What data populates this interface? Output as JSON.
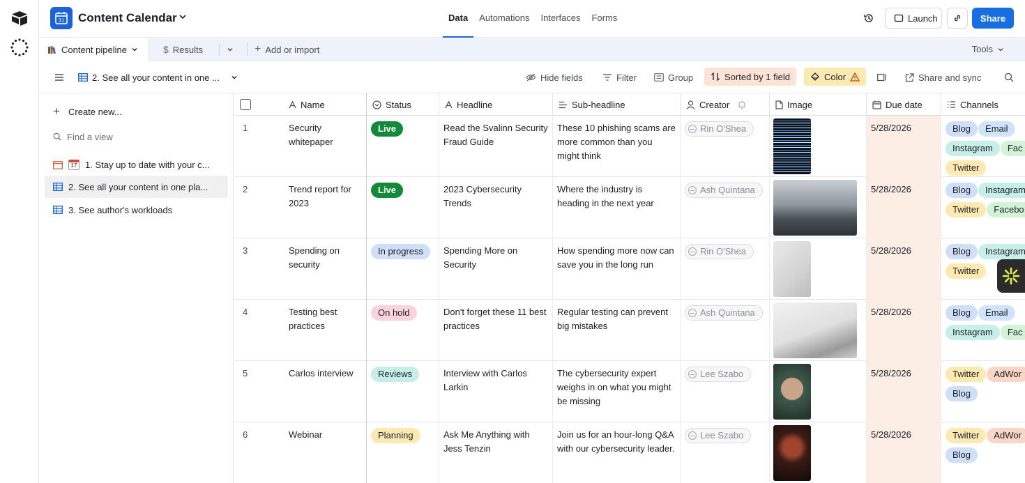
{
  "app": {
    "base_title": "Content Calendar",
    "base_icon_day": "31",
    "tabs": [
      {
        "label": "Data",
        "active": true
      },
      {
        "label": "Automations",
        "active": false
      },
      {
        "label": "Interfaces",
        "active": false
      },
      {
        "label": "Forms",
        "active": false
      }
    ],
    "launch_label": "Launch",
    "share_label": "Share",
    "brand_color": "#166ee1"
  },
  "tablebar": {
    "active_table": "Content pipeline",
    "other_table": "Results",
    "add_label": "Add or import",
    "tools_label": "Tools"
  },
  "viewbar": {
    "view_name": "2. See all your content in one ...",
    "hide_fields": "Hide fields",
    "filter": "Filter",
    "group": "Group",
    "sorted": "Sorted by 1 field",
    "color": "Color",
    "share_sync": "Share and sync"
  },
  "sidebar": {
    "create_new": "Create new...",
    "find_view": "Find a view",
    "views": [
      {
        "label": "1. Stay up to date with your c...",
        "type": "calendar",
        "active": false
      },
      {
        "label": "2. See all your content in one pla...",
        "type": "grid",
        "active": true
      },
      {
        "label": "3. See author's workloads",
        "type": "grid",
        "active": false
      }
    ]
  },
  "columns": [
    "Name",
    "Status",
    "Headline",
    "Sub-headline",
    "Creator",
    "Image",
    "Due date",
    "Channels"
  ],
  "status_colors": {
    "Live": {
      "bg": "#138a3a",
      "fg": "#ffffff"
    },
    "In progress": {
      "bg": "#cfdff8",
      "fg": "#1d1f25"
    },
    "On hold": {
      "bg": "#fbd3dc",
      "fg": "#1d1f25"
    },
    "Reviews": {
      "bg": "#c6efe9",
      "fg": "#1d1f25"
    },
    "Planning": {
      "bg": "#fde9b2",
      "fg": "#1d1f25"
    }
  },
  "channel_colors": {
    "Blog": "#cfdff8",
    "Email": "#cfe4fb",
    "Instagram": "#c6efe9",
    "Facebook": "#d2f3d6",
    "Twitter": "#fde9b2",
    "AdWords": "#fbd6c6"
  },
  "rows": [
    {
      "num": "1",
      "name": "Security whitepaper",
      "status": "Live",
      "headline": "Read the Svalinn Security Fraud Guide",
      "sub": "These 10 phishing scams are more common than you might think",
      "creator": "Rin O'Shea",
      "due": "5/28/2026",
      "channels": [
        "Blog",
        "Email",
        "Instagram",
        "Fac",
        "Twitter"
      ],
      "image": "code"
    },
    {
      "num": "2",
      "name": "Trend report for 2023",
      "status": "Live",
      "headline": "2023 Cybersecurity Trends",
      "sub": "Where the industry is heading in the next year",
      "creator": "Ash Quintana",
      "due": "5/28/2026",
      "channels": [
        "Blog",
        "Instagram",
        "Twitter",
        "Facebo"
      ],
      "image": "office"
    },
    {
      "num": "3",
      "name": "Spending on security",
      "status": "In progress",
      "headline": "Spending More on Security",
      "sub": "How spending more now can save you in the long run",
      "creator": "Rin O'Shea",
      "due": "5/28/2026",
      "channels": [
        "Blog",
        "Instagram",
        "Twitter"
      ],
      "image": "hand"
    },
    {
      "num": "4",
      "name": "Testing best practices",
      "status": "On hold",
      "headline": "Don't forget these 11 best practices",
      "sub": "Regular testing can prevent big mistakes",
      "creator": "Ash Quintana",
      "due": "5/28/2026",
      "channels": [
        "Blog",
        "Email",
        "Instagram",
        "Fac"
      ],
      "image": "laptop"
    },
    {
      "num": "5",
      "name": "Carlos interview",
      "status": "Reviews",
      "headline": "Interview with Carlos Larkin",
      "sub": "The cybersecurity expert weighs in on what you might be missing",
      "creator": "Lee Szabo",
      "due": "5/28/2026",
      "channels": [
        "Twitter",
        "AdWor",
        "Blog"
      ],
      "image": "face"
    },
    {
      "num": "6",
      "name": "Webinar",
      "status": "Planning",
      "headline": "Ask Me Anything with Jess Tenzin",
      "sub": "Join us for an hour-long Q&A with our cybersecurity leader.",
      "creator": "Lee Szabo",
      "due": "5/28/2026",
      "channels": [
        "Twitter",
        "AdWor",
        "Blog"
      ],
      "image": "portrait"
    }
  ]
}
